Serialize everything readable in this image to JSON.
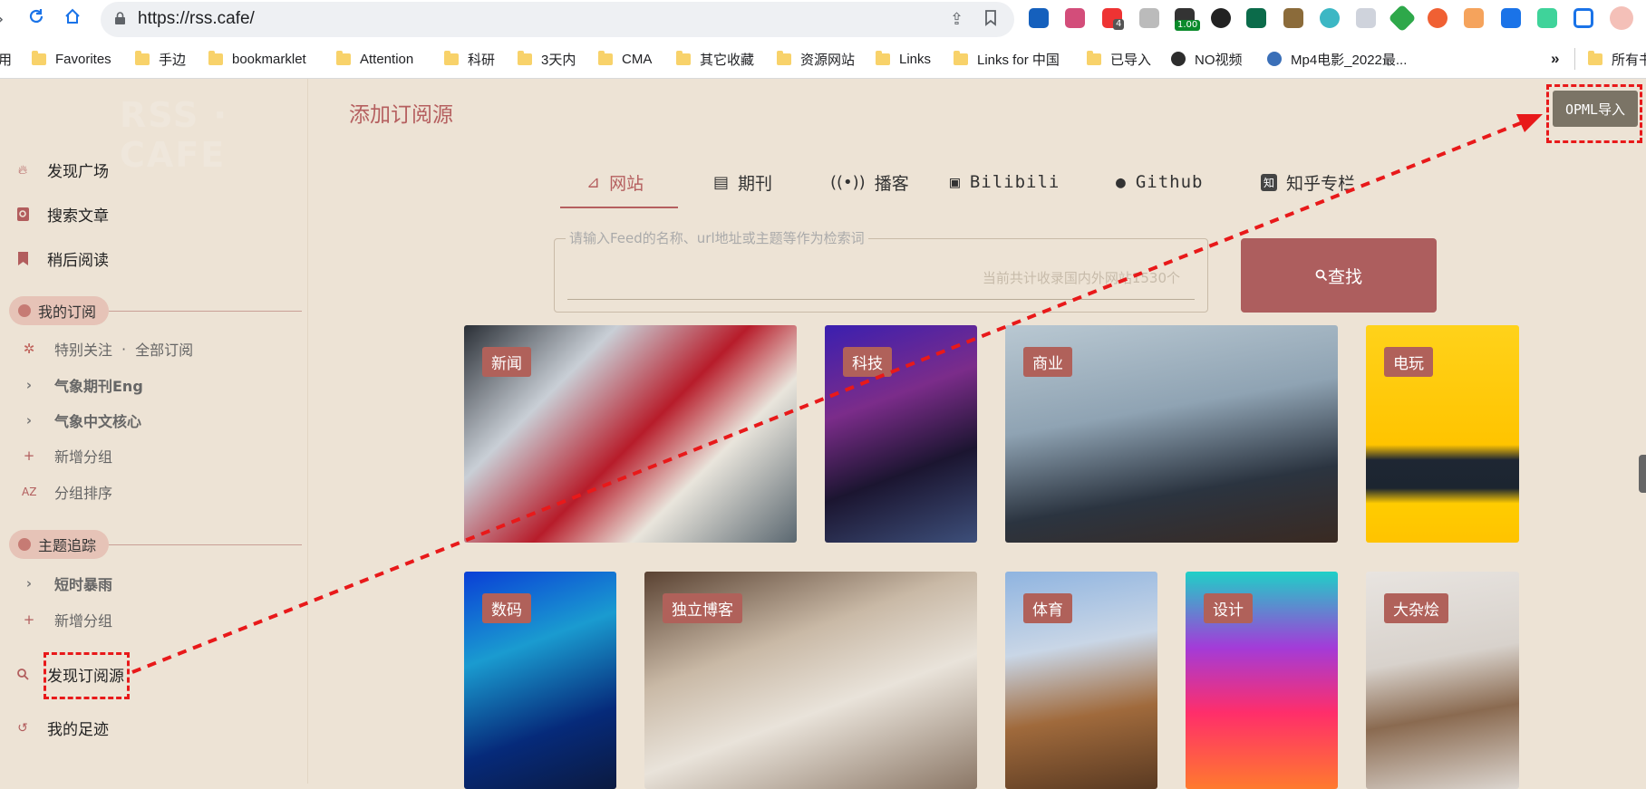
{
  "browser": {
    "url": "https://rss.cafe/",
    "bookmarks": [
      {
        "label": "用",
        "icon": "none"
      },
      {
        "label": "Favorites",
        "icon": "folder"
      },
      {
        "label": "手边",
        "icon": "folder"
      },
      {
        "label": "bookmarklet",
        "icon": "folder"
      },
      {
        "label": "Attention",
        "icon": "folder"
      },
      {
        "label": "科研",
        "icon": "folder"
      },
      {
        "label": "3天内",
        "icon": "folder"
      },
      {
        "label": "CMA",
        "icon": "folder"
      },
      {
        "label": "其它收藏",
        "icon": "folder"
      },
      {
        "label": "资源网站",
        "icon": "folder"
      },
      {
        "label": "Links",
        "icon": "folder"
      },
      {
        "label": "Links for 中国",
        "icon": "folder"
      },
      {
        "label": "已导入",
        "icon": "folder"
      },
      {
        "label": "NO视频",
        "icon": "globe"
      },
      {
        "label": "Mp4电影_2022最...",
        "icon": "globe"
      }
    ],
    "more_label": "»",
    "all_bookmarks_label": "所有书",
    "extension_badges": {
      "badge1": "4",
      "badge2": "1.00"
    }
  },
  "app": {
    "brand": "RSS · CAFE",
    "page_title": "添加订阅源",
    "opml_button": "OPML导入",
    "nav": {
      "discover": "发现广场",
      "search_articles": "搜索文章",
      "read_later": "稍后阅读",
      "discover_feeds": "发现订阅源",
      "history": "我的足迹"
    },
    "my_subscriptions": {
      "title": "我的订阅",
      "special": "特别关注",
      "separator": "·",
      "all": "全部订阅",
      "groups": [
        "气象期刊Eng",
        "气象中文核心"
      ],
      "add_group": "新增分组",
      "sort_groups": "分组排序"
    },
    "topics": {
      "title": "主题追踪",
      "groups": [
        "短时暴雨"
      ],
      "add_group": "新增分组"
    },
    "tabs": [
      {
        "label": "网站",
        "icon": "rss-icon",
        "active": true
      },
      {
        "label": "期刊",
        "icon": "journal-icon",
        "active": false
      },
      {
        "label": "播客",
        "icon": "podcast-icon",
        "active": false
      },
      {
        "label": "Bilibili",
        "icon": "bilibili-icon",
        "active": false
      },
      {
        "label": "Github",
        "icon": "github-icon",
        "active": false
      },
      {
        "label": "知乎专栏",
        "icon": "zhihu-icon",
        "active": false
      }
    ],
    "search": {
      "legend": "请输入Feed的名称、url地址或主题等作为检索词",
      "count_hint": "当前共计收录国内外网站1530个",
      "button": "查找"
    },
    "categories": [
      {
        "label": "新闻"
      },
      {
        "label": "科技"
      },
      {
        "label": "商业"
      },
      {
        "label": "电玩"
      },
      {
        "label": "数码"
      },
      {
        "label": "独立博客"
      },
      {
        "label": "体育"
      },
      {
        "label": "设计"
      },
      {
        "label": "大杂烩"
      }
    ]
  },
  "colors": {
    "accent": "#b55f5f",
    "background": "#ede3d5",
    "annotation": "#e8191a"
  }
}
